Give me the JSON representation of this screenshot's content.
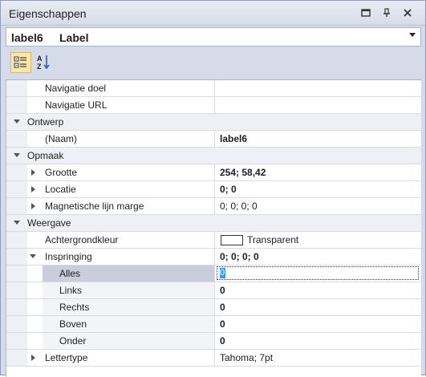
{
  "panel": {
    "title": "Eigenschappen"
  },
  "titlebar_icons": [
    "window-position-icon",
    "pin-icon",
    "close-icon"
  ],
  "object_selector": {
    "name": "label6",
    "type": "Label"
  },
  "toolbar": {
    "categorized_icon": "categorized-view-icon",
    "alphabetical_icon": "alphabetical-sort-icon"
  },
  "grid": {
    "rows": [
      {
        "kind": "prop",
        "name": "Navigatie doel",
        "value": ""
      },
      {
        "kind": "prop",
        "name": "Navigatie URL",
        "value": ""
      },
      {
        "kind": "cat",
        "name": "Ontwerp"
      },
      {
        "kind": "prop",
        "name": "(Naam)",
        "value": "label6",
        "bold": true
      },
      {
        "kind": "cat",
        "name": "Opmaak"
      },
      {
        "kind": "prop",
        "name": "Grootte",
        "value": "254; 58,42",
        "bold": true,
        "expander": "collapsed"
      },
      {
        "kind": "prop",
        "name": "Locatie",
        "value": "0; 0",
        "bold": true,
        "expander": "collapsed"
      },
      {
        "kind": "prop",
        "name": "Magnetische lijn marge",
        "value": "0; 0; 0; 0",
        "expander": "collapsed"
      },
      {
        "kind": "cat",
        "name": "Weergave"
      },
      {
        "kind": "prop",
        "name": "Achtergrondkleur",
        "value": "Transparent",
        "swatch": true
      },
      {
        "kind": "prop",
        "name": "Inspringing",
        "value": "0; 0; 0; 0",
        "bold": true,
        "expander": "expanded"
      },
      {
        "kind": "sub",
        "name": "Alles",
        "value": "0",
        "bold": true,
        "selected": true
      },
      {
        "kind": "sub",
        "name": "Links",
        "value": "0",
        "bold": true
      },
      {
        "kind": "sub",
        "name": "Rechts",
        "value": "0",
        "bold": true
      },
      {
        "kind": "sub",
        "name": "Boven",
        "value": "0",
        "bold": true
      },
      {
        "kind": "sub",
        "name": "Onder",
        "value": "0",
        "bold": true
      },
      {
        "kind": "prop",
        "name": "Lettertype",
        "value": "Tahoma; 7pt",
        "expander": "collapsed",
        "partial": true
      }
    ]
  }
}
